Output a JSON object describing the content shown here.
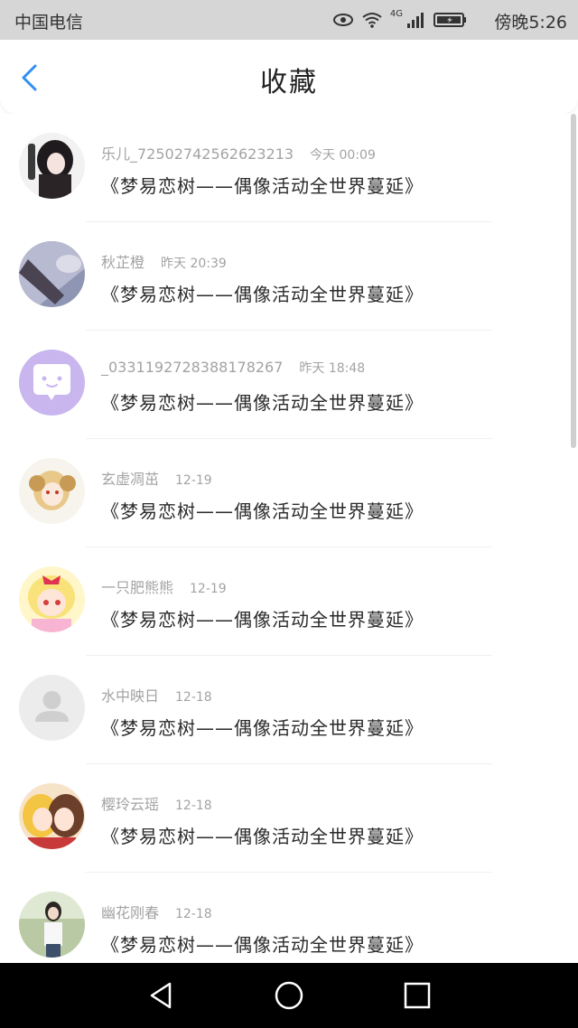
{
  "status_bar": {
    "carrier": "中国电信",
    "network": "4G",
    "time": "傍晚5:26"
  },
  "header": {
    "title": "收藏",
    "back_icon": "chevron-left-icon",
    "accent_color": "#2f8ff2"
  },
  "favorites": [
    {
      "name": "乐儿_72502742562623213",
      "time": "今天 00:09",
      "topic": "《梦易恋树——偶像活动全世界蔓延》"
    },
    {
      "name": "秋芷橙",
      "time": "昨天 20:39",
      "topic": "《梦易恋树——偶像活动全世界蔓延》"
    },
    {
      "name": "_0331192728388178267",
      "time": "昨天 18:48",
      "topic": "《梦易恋树——偶像活动全世界蔓延》"
    },
    {
      "name": "玄虚凋茁",
      "time": "12-19",
      "topic": "《梦易恋树——偶像活动全世界蔓延》"
    },
    {
      "name": "一只肥熊熊",
      "time": "12-19",
      "topic": "《梦易恋树——偶像活动全世界蔓延》"
    },
    {
      "name": "水中映日",
      "time": "12-18",
      "topic": "《梦易恋树——偶像活动全世界蔓延》"
    },
    {
      "name": "樱玲云瑶",
      "time": "12-18",
      "topic": "《梦易恋树——偶像活动全世界蔓延》"
    },
    {
      "name": "幽花刚春",
      "time": "12-18",
      "topic": "《梦易恋树——偶像活动全世界蔓延》"
    }
  ],
  "system_nav": {
    "back_icon": "triangle-back-icon",
    "home_icon": "circle-home-icon",
    "recents_icon": "square-recents-icon"
  }
}
